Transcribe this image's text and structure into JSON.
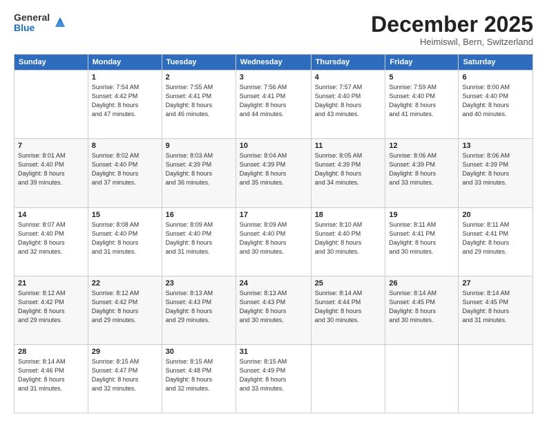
{
  "logo": {
    "general": "General",
    "blue": "Blue"
  },
  "header": {
    "month": "December 2025",
    "location": "Heimiswil, Bern, Switzerland"
  },
  "weekdays": [
    "Sunday",
    "Monday",
    "Tuesday",
    "Wednesday",
    "Thursday",
    "Friday",
    "Saturday"
  ],
  "weeks": [
    [
      {
        "day": "",
        "info": ""
      },
      {
        "day": "1",
        "info": "Sunrise: 7:54 AM\nSunset: 4:42 PM\nDaylight: 8 hours\nand 47 minutes."
      },
      {
        "day": "2",
        "info": "Sunrise: 7:55 AM\nSunset: 4:41 PM\nDaylight: 8 hours\nand 46 minutes."
      },
      {
        "day": "3",
        "info": "Sunrise: 7:56 AM\nSunset: 4:41 PM\nDaylight: 8 hours\nand 44 minutes."
      },
      {
        "day": "4",
        "info": "Sunrise: 7:57 AM\nSunset: 4:40 PM\nDaylight: 8 hours\nand 43 minutes."
      },
      {
        "day": "5",
        "info": "Sunrise: 7:59 AM\nSunset: 4:40 PM\nDaylight: 8 hours\nand 41 minutes."
      },
      {
        "day": "6",
        "info": "Sunrise: 8:00 AM\nSunset: 4:40 PM\nDaylight: 8 hours\nand 40 minutes."
      }
    ],
    [
      {
        "day": "7",
        "info": "Sunrise: 8:01 AM\nSunset: 4:40 PM\nDaylight: 8 hours\nand 39 minutes."
      },
      {
        "day": "8",
        "info": "Sunrise: 8:02 AM\nSunset: 4:40 PM\nDaylight: 8 hours\nand 37 minutes."
      },
      {
        "day": "9",
        "info": "Sunrise: 8:03 AM\nSunset: 4:39 PM\nDaylight: 8 hours\nand 36 minutes."
      },
      {
        "day": "10",
        "info": "Sunrise: 8:04 AM\nSunset: 4:39 PM\nDaylight: 8 hours\nand 35 minutes."
      },
      {
        "day": "11",
        "info": "Sunrise: 8:05 AM\nSunset: 4:39 PM\nDaylight: 8 hours\nand 34 minutes."
      },
      {
        "day": "12",
        "info": "Sunrise: 8:06 AM\nSunset: 4:39 PM\nDaylight: 8 hours\nand 33 minutes."
      },
      {
        "day": "13",
        "info": "Sunrise: 8:06 AM\nSunset: 4:39 PM\nDaylight: 8 hours\nand 33 minutes."
      }
    ],
    [
      {
        "day": "14",
        "info": "Sunrise: 8:07 AM\nSunset: 4:40 PM\nDaylight: 8 hours\nand 32 minutes."
      },
      {
        "day": "15",
        "info": "Sunrise: 8:08 AM\nSunset: 4:40 PM\nDaylight: 8 hours\nand 31 minutes."
      },
      {
        "day": "16",
        "info": "Sunrise: 8:09 AM\nSunset: 4:40 PM\nDaylight: 8 hours\nand 31 minutes."
      },
      {
        "day": "17",
        "info": "Sunrise: 8:09 AM\nSunset: 4:40 PM\nDaylight: 8 hours\nand 30 minutes."
      },
      {
        "day": "18",
        "info": "Sunrise: 8:10 AM\nSunset: 4:40 PM\nDaylight: 8 hours\nand 30 minutes."
      },
      {
        "day": "19",
        "info": "Sunrise: 8:11 AM\nSunset: 4:41 PM\nDaylight: 8 hours\nand 30 minutes."
      },
      {
        "day": "20",
        "info": "Sunrise: 8:11 AM\nSunset: 4:41 PM\nDaylight: 8 hours\nand 29 minutes."
      }
    ],
    [
      {
        "day": "21",
        "info": "Sunrise: 8:12 AM\nSunset: 4:42 PM\nDaylight: 8 hours\nand 29 minutes."
      },
      {
        "day": "22",
        "info": "Sunrise: 8:12 AM\nSunset: 4:42 PM\nDaylight: 8 hours\nand 29 minutes."
      },
      {
        "day": "23",
        "info": "Sunrise: 8:13 AM\nSunset: 4:43 PM\nDaylight: 8 hours\nand 29 minutes."
      },
      {
        "day": "24",
        "info": "Sunrise: 8:13 AM\nSunset: 4:43 PM\nDaylight: 8 hours\nand 30 minutes."
      },
      {
        "day": "25",
        "info": "Sunrise: 8:14 AM\nSunset: 4:44 PM\nDaylight: 8 hours\nand 30 minutes."
      },
      {
        "day": "26",
        "info": "Sunrise: 8:14 AM\nSunset: 4:45 PM\nDaylight: 8 hours\nand 30 minutes."
      },
      {
        "day": "27",
        "info": "Sunrise: 8:14 AM\nSunset: 4:45 PM\nDaylight: 8 hours\nand 31 minutes."
      }
    ],
    [
      {
        "day": "28",
        "info": "Sunrise: 8:14 AM\nSunset: 4:46 PM\nDaylight: 8 hours\nand 31 minutes."
      },
      {
        "day": "29",
        "info": "Sunrise: 8:15 AM\nSunset: 4:47 PM\nDaylight: 8 hours\nand 32 minutes."
      },
      {
        "day": "30",
        "info": "Sunrise: 8:15 AM\nSunset: 4:48 PM\nDaylight: 8 hours\nand 32 minutes."
      },
      {
        "day": "31",
        "info": "Sunrise: 8:15 AM\nSunset: 4:49 PM\nDaylight: 8 hours\nand 33 minutes."
      },
      {
        "day": "",
        "info": ""
      },
      {
        "day": "",
        "info": ""
      },
      {
        "day": "",
        "info": ""
      }
    ]
  ]
}
